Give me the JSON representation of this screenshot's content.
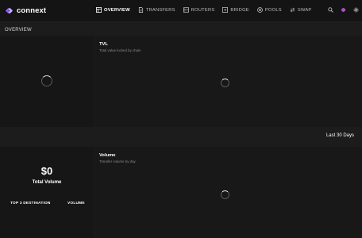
{
  "app": {
    "name": "connext"
  },
  "nav": {
    "items": [
      {
        "label": "OVERVIEW",
        "icon": "grid-icon",
        "active": true
      },
      {
        "label": "TRANSFERS",
        "icon": "document-icon",
        "active": false
      },
      {
        "label": "ROUTERS",
        "icon": "server-icon",
        "active": false
      },
      {
        "label": "BRIDGE",
        "icon": "bridge-icon",
        "active": false
      },
      {
        "label": "POOLS",
        "icon": "pool-icon",
        "active": false
      },
      {
        "label": "SWAP",
        "icon": "swap-icon",
        "active": false
      }
    ]
  },
  "header_actions": {
    "search_icon": "search-icon",
    "brand_icon": "connext-icon",
    "settings_icon": "gear-icon"
  },
  "overview": {
    "title": "OVERVIEW"
  },
  "tvl": {
    "title": "TVL",
    "subtitle": "Total value locked by chain"
  },
  "period": {
    "label": "Last 30 Days"
  },
  "volume_summary": {
    "value": "$0",
    "label": "Total Volume",
    "col_destination": "TOP 3 DESTINATION",
    "col_volume": "VOLUME"
  },
  "volume": {
    "title": "Volume",
    "subtitle": "Transfer volume by day"
  },
  "colors": {
    "background": "#1c1c1c",
    "topbar": "#141414",
    "panel": "#181818",
    "brand_purple": "#8b5cf6",
    "brand_pink": "#e74c9c"
  }
}
